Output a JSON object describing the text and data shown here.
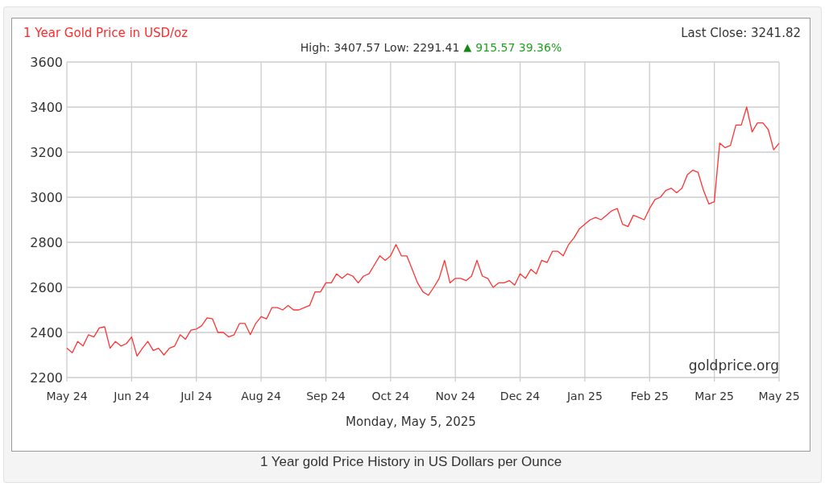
{
  "chart": {
    "title": "1 Year Gold Price in USD/oz",
    "last_close": "Last Close: 3241.82",
    "high_low": "High: 3407.57 Low: 2291.41",
    "change_arrow": "▲",
    "change": "915.57 39.36%",
    "source_label": "goldprice.org",
    "date": "Monday, May 5, 2025",
    "chart_data": {
      "type": "line",
      "grid": true,
      "ylim": [
        2200,
        3600
      ],
      "categories": [
        "May 24",
        null,
        null,
        null,
        null,
        null,
        null,
        null,
        null,
        null,
        null,
        null,
        "Jun 24",
        null,
        null,
        null,
        null,
        null,
        null,
        null,
        null,
        null,
        null,
        null,
        "Jul 24",
        null,
        null,
        null,
        null,
        null,
        null,
        null,
        null,
        null,
        null,
        null,
        "Aug 24",
        null,
        null,
        null,
        null,
        null,
        null,
        null,
        null,
        null,
        null,
        null,
        "Sep 24",
        null,
        null,
        null,
        null,
        null,
        null,
        null,
        null,
        null,
        null,
        null,
        "Oct 24",
        null,
        null,
        null,
        null,
        null,
        null,
        null,
        null,
        null,
        null,
        null,
        "Nov 24",
        null,
        null,
        null,
        null,
        null,
        null,
        null,
        null,
        null,
        null,
        null,
        "Dec 24",
        null,
        null,
        null,
        null,
        null,
        null,
        null,
        null,
        null,
        null,
        null,
        "Jan 25",
        null,
        null,
        null,
        null,
        null,
        null,
        null,
        null,
        null,
        null,
        null,
        "Feb 25",
        null,
        null,
        null,
        null,
        null,
        null,
        null,
        null,
        null,
        null,
        null,
        "Mar 25",
        null,
        null,
        null,
        null,
        null,
        null,
        null,
        null,
        null,
        null,
        null,
        "May 25"
      ],
      "yticks": [
        2200,
        2400,
        2600,
        2800,
        3000,
        3200,
        3400,
        3600
      ],
      "series": [
        {
          "color": "#ff3333",
          "values": [
            2330,
            2310,
            2360,
            2340,
            2390,
            2380,
            2420,
            2425,
            2330,
            2360,
            2340,
            2350,
            2380,
            2295,
            2330,
            2360,
            2320,
            2330,
            2300,
            2330,
            2340,
            2390,
            2370,
            2410,
            2415,
            2430,
            2465,
            2460,
            2400,
            2400,
            2380,
            2390,
            2440,
            2440,
            2390,
            2440,
            2470,
            2460,
            2510,
            2510,
            2500,
            2520,
            2500,
            2500,
            2510,
            2520,
            2580,
            2580,
            2620,
            2620,
            2660,
            2640,
            2660,
            2650,
            2620,
            2650,
            2660,
            2700,
            2740,
            2720,
            2740,
            2790,
            2740,
            2740,
            2680,
            2620,
            2580,
            2565,
            2600,
            2640,
            2720,
            2620,
            2640,
            2640,
            2630,
            2650,
            2720,
            2650,
            2640,
            2600,
            2620,
            2620,
            2630,
            2610,
            2660,
            2640,
            2680,
            2660,
            2720,
            2710,
            2760,
            2760,
            2740,
            2790,
            2820,
            2860,
            2880,
            2900,
            2910,
            2900,
            2920,
            2940,
            2950,
            2880,
            2870,
            2920,
            2910,
            2900,
            2950,
            2990,
            3000,
            3030,
            3040,
            3020,
            3040,
            3100,
            3120,
            3110,
            3030,
            2970,
            2980,
            3240,
            3220,
            3230,
            3320,
            3320,
            3400,
            3290,
            3330,
            3330,
            3300,
            3210,
            3240
          ]
        }
      ]
    }
  },
  "caption": "1 Year gold Price History in US Dollars per Ounce"
}
